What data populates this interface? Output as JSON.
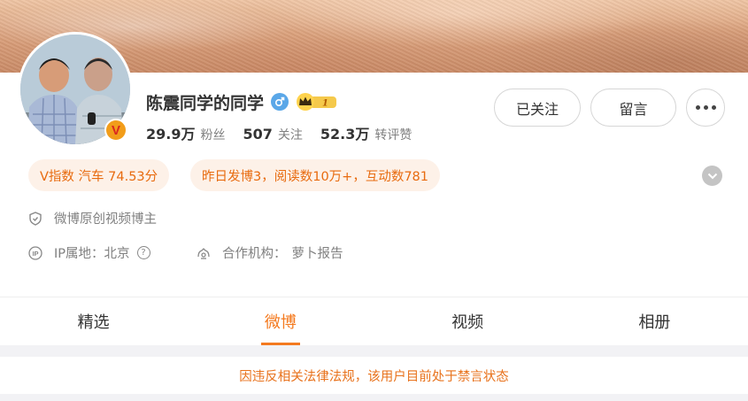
{
  "profile": {
    "name": "陈震同学的同学",
    "verified_badge": "V",
    "member_level": "1",
    "icons": {
      "gender": "male-gender-icon",
      "member": "crown-member-icon",
      "verified": "orange-v-verified-icon"
    }
  },
  "stats": [
    {
      "value": "29.9万",
      "label": "粉丝"
    },
    {
      "value": "507",
      "label": "关注"
    },
    {
      "value": "52.3万",
      "label": "转评赞"
    }
  ],
  "actions": {
    "follow_label": "已关注",
    "message_label": "留言",
    "more_icon": "more-dots-icon"
  },
  "tags": {
    "v_index": "V指数 汽车 74.53分",
    "post_summary": "昨日发博3，阅读数10万+，互动数781"
  },
  "info": {
    "creator": "微博原创视频博主",
    "ip_label": "IP属地：北京",
    "agency_label": "合作机构：",
    "agency_value": "萝卜报告"
  },
  "tabs": [
    {
      "label": "精选",
      "active": false
    },
    {
      "label": "微博",
      "active": true
    },
    {
      "label": "视频",
      "active": false
    },
    {
      "label": "相册",
      "active": false
    }
  ],
  "notice": "因违反相关法律法规，该用户目前处于禁言状态",
  "colors": {
    "accent": "#f47a1f",
    "tag_bg": "#fdf1e8",
    "gender_blue": "#5aa7e8",
    "verified_orange": "#f29d1a"
  }
}
